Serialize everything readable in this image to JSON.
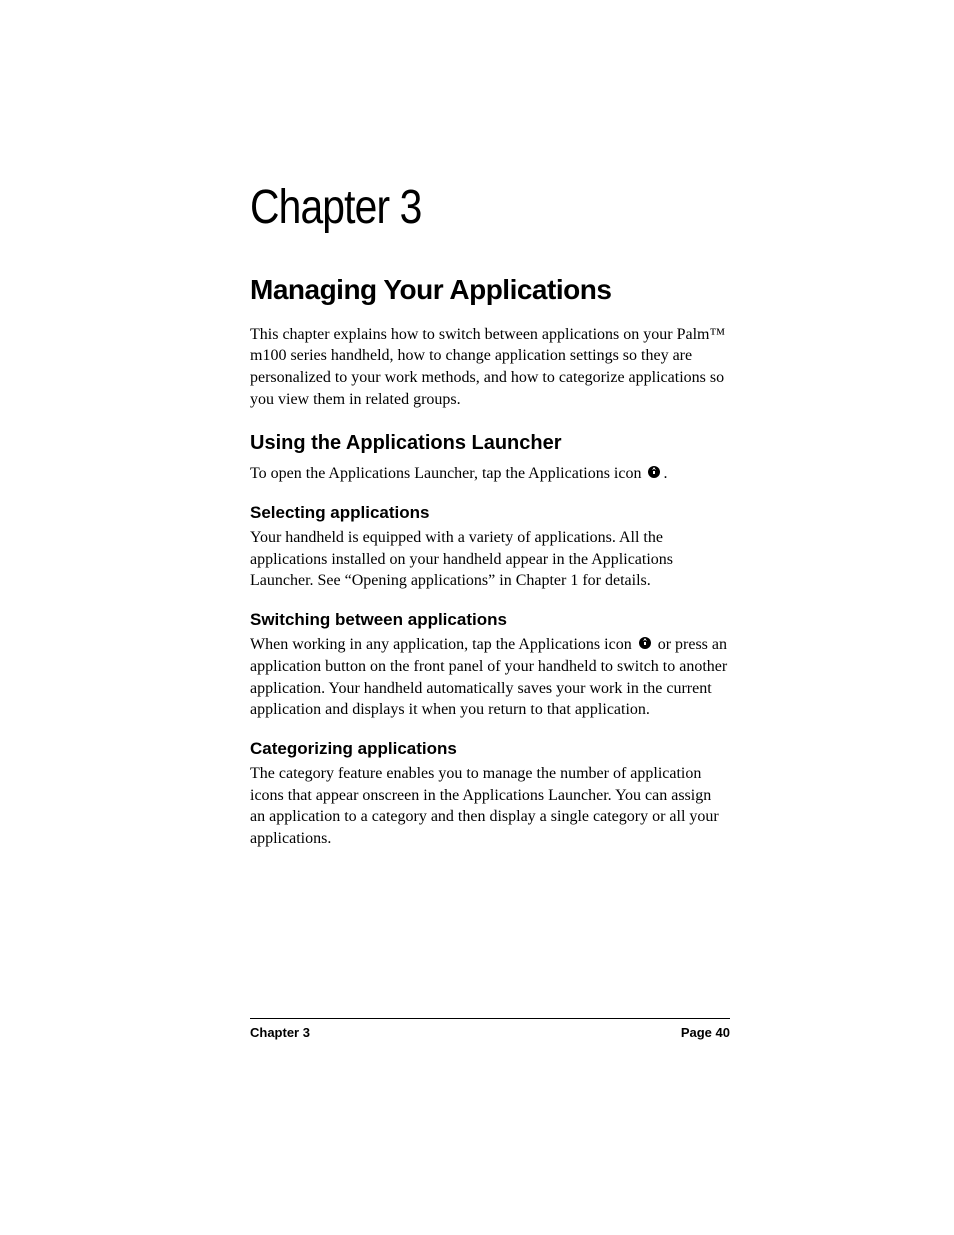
{
  "chapter_title": "Chapter 3",
  "main_heading": "Managing Your Applications",
  "intro": "This chapter explains how to switch between applications on your Palm™ m100 series handheld, how to change application settings so they are personalized to your work methods, and how to categorize applications so you view them in related groups.",
  "sections": {
    "launcher": {
      "heading": "Using the Applications Launcher",
      "intro_before_icon": "To open the Applications Launcher, tap the Applications icon ",
      "intro_after_icon": ".",
      "subsections": {
        "selecting": {
          "heading": "Selecting applications",
          "body": "Your handheld is equipped with a variety of applications. All the applications installed on your handheld appear in the Applications Launcher. See “Opening applications” in Chapter 1 for details."
        },
        "switching": {
          "heading": "Switching between applications",
          "body_before_icon": "When working in any application, tap the Applications icon ",
          "body_after_icon": " or press an application button on the front panel of your handheld to switch to another application. Your handheld automatically saves your work in the current application and displays it when you return to that application."
        },
        "categorizing": {
          "heading": "Categorizing applications",
          "body": "The category feature enables you to manage the number of application icons that appear onscreen in the Applications Launcher. You can assign an application to a category and then display a single category or all your applications."
        }
      }
    }
  },
  "footer": {
    "left": "Chapter 3",
    "right": "Page 40"
  }
}
